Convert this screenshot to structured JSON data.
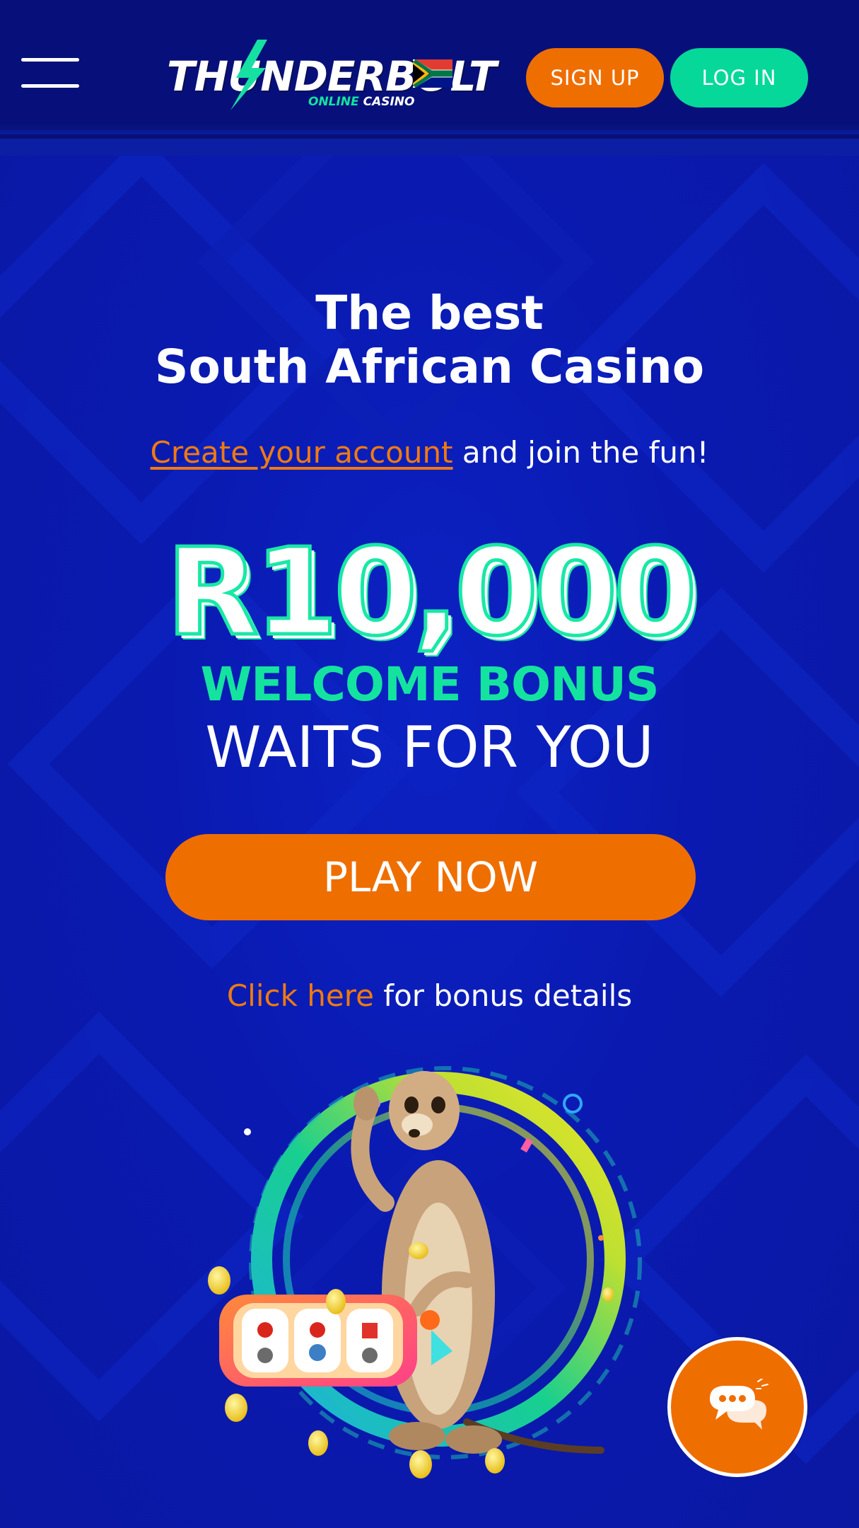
{
  "header": {
    "menu_icon": "hamburger-menu-icon",
    "logo": {
      "main_text": "THUNDERBOLT",
      "sub_text_left": "ONLINE",
      "sub_text_right": "CASINO",
      "flag_icon": "south-africa-flag-icon",
      "bolt_icon": "lightning-bolt-icon"
    },
    "signup_label": "SIGN UP",
    "login_label": "LOG IN"
  },
  "hero": {
    "title_line1": "The best",
    "title_line2": "South African Casino",
    "subtitle_link": "Create your account",
    "subtitle_rest": " and join the fun!",
    "amount": "R10,000",
    "welcome": "WELCOME BONUS",
    "waits": "WAITS FOR YOU",
    "play_label": "PLAY NOW",
    "details_link": "Click here",
    "details_rest": " for bonus details",
    "illustration": "meerkat-slot-machine-illustration"
  },
  "chat": {
    "icon": "chat-bubbles-icon"
  },
  "colors": {
    "background": "#0a1aa8",
    "header": "#07107a",
    "orange": "#ef6e00",
    "green": "#06d89a",
    "link_orange": "#f07a10"
  }
}
